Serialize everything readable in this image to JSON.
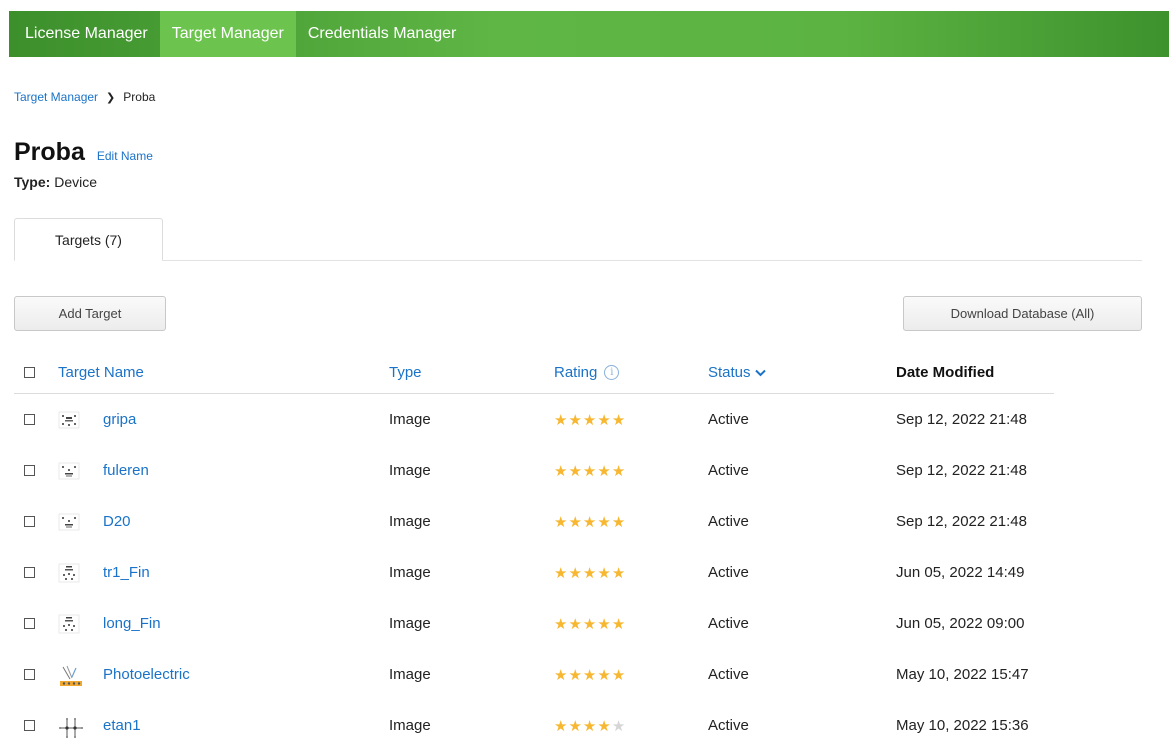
{
  "nav": {
    "items": [
      {
        "label": "License Manager",
        "active": false
      },
      {
        "label": "Target Manager",
        "active": true
      },
      {
        "label": "Credentials Manager",
        "active": false
      }
    ]
  },
  "breadcrumb": {
    "parent": "Target Manager",
    "current": "Proba"
  },
  "page": {
    "title": "Proba",
    "edit_label": "Edit Name",
    "type_label": "Type:",
    "type_value": "Device"
  },
  "tabs": [
    {
      "label": "Targets (7)"
    }
  ],
  "toolbar": {
    "add_label": "Add Target",
    "download_label": "Download Database (All)"
  },
  "table": {
    "headers": {
      "name": "Target Name",
      "type": "Type",
      "rating": "Rating",
      "status": "Status",
      "date": "Date Modified"
    },
    "rows": [
      {
        "name": "gripa",
        "type": "Image",
        "rating": 5,
        "status": "Active",
        "date": "Sep 12, 2022 21:48",
        "thumb": "molecule-grid"
      },
      {
        "name": "fuleren",
        "type": "Image",
        "rating": 5,
        "status": "Active",
        "date": "Sep 12, 2022 21:48",
        "thumb": "molecule-triangle"
      },
      {
        "name": "D20",
        "type": "Image",
        "rating": 5,
        "status": "Active",
        "date": "Sep 12, 2022 21:48",
        "thumb": "molecule-triangle"
      },
      {
        "name": "tr1_Fin",
        "type": "Image",
        "rating": 5,
        "status": "Active",
        "date": "Jun 05, 2022 14:49",
        "thumb": "molecule-stack"
      },
      {
        "name": "long_Fin",
        "type": "Image",
        "rating": 5,
        "status": "Active",
        "date": "Jun 05, 2022 09:00",
        "thumb": "molecule-stack"
      },
      {
        "name": "Photoelectric",
        "type": "Image",
        "rating": 5,
        "status": "Active",
        "date": "May 10, 2022 15:47",
        "thumb": "photoelectric"
      },
      {
        "name": "etan1",
        "type": "Image",
        "rating": 4,
        "status": "Active",
        "date": "May 10, 2022 15:36",
        "thumb": "ethane-structure"
      }
    ]
  },
  "colors": {
    "nav_green": "#5fb645",
    "nav_active": "#6cc44f",
    "link_blue": "#1a73c8",
    "star": "#f7b731",
    "star_off": "#d6d6d6"
  }
}
